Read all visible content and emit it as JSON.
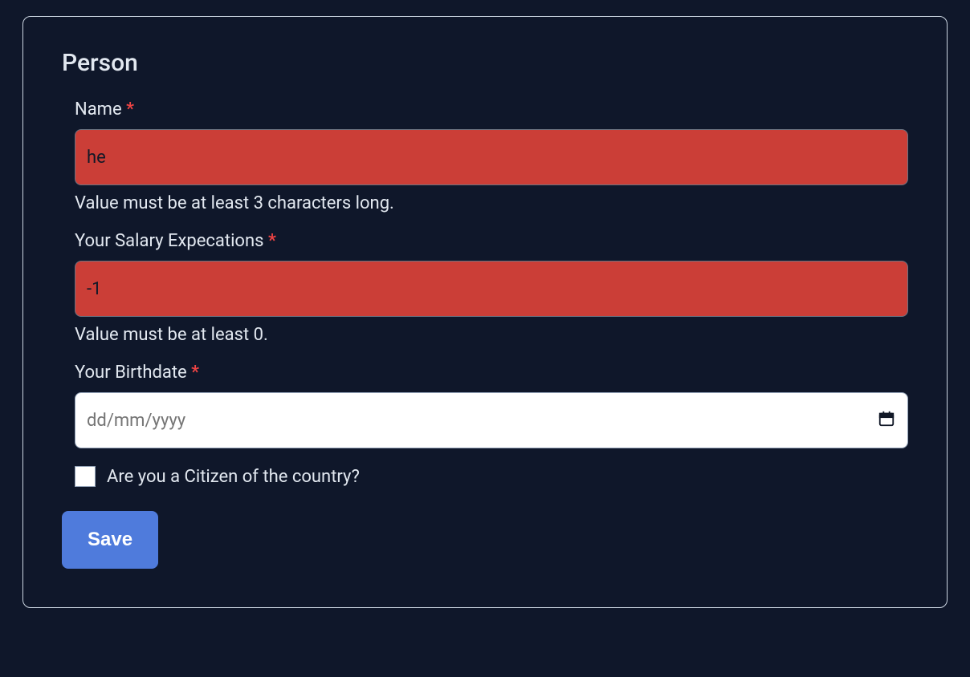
{
  "form": {
    "title": "Person",
    "required_mark": "*",
    "fields": {
      "name": {
        "label": "Name",
        "value": "he",
        "error": "Value must be at least 3 characters long."
      },
      "salary": {
        "label": "Your Salary Expecations",
        "value": "-1",
        "error": "Value must be at least 0."
      },
      "birthdate": {
        "label": "Your Birthdate",
        "placeholder": "dd/mm/yyyy",
        "value": ""
      },
      "citizen": {
        "label": "Are you a Citizen of the country?"
      }
    },
    "save_label": "Save"
  }
}
